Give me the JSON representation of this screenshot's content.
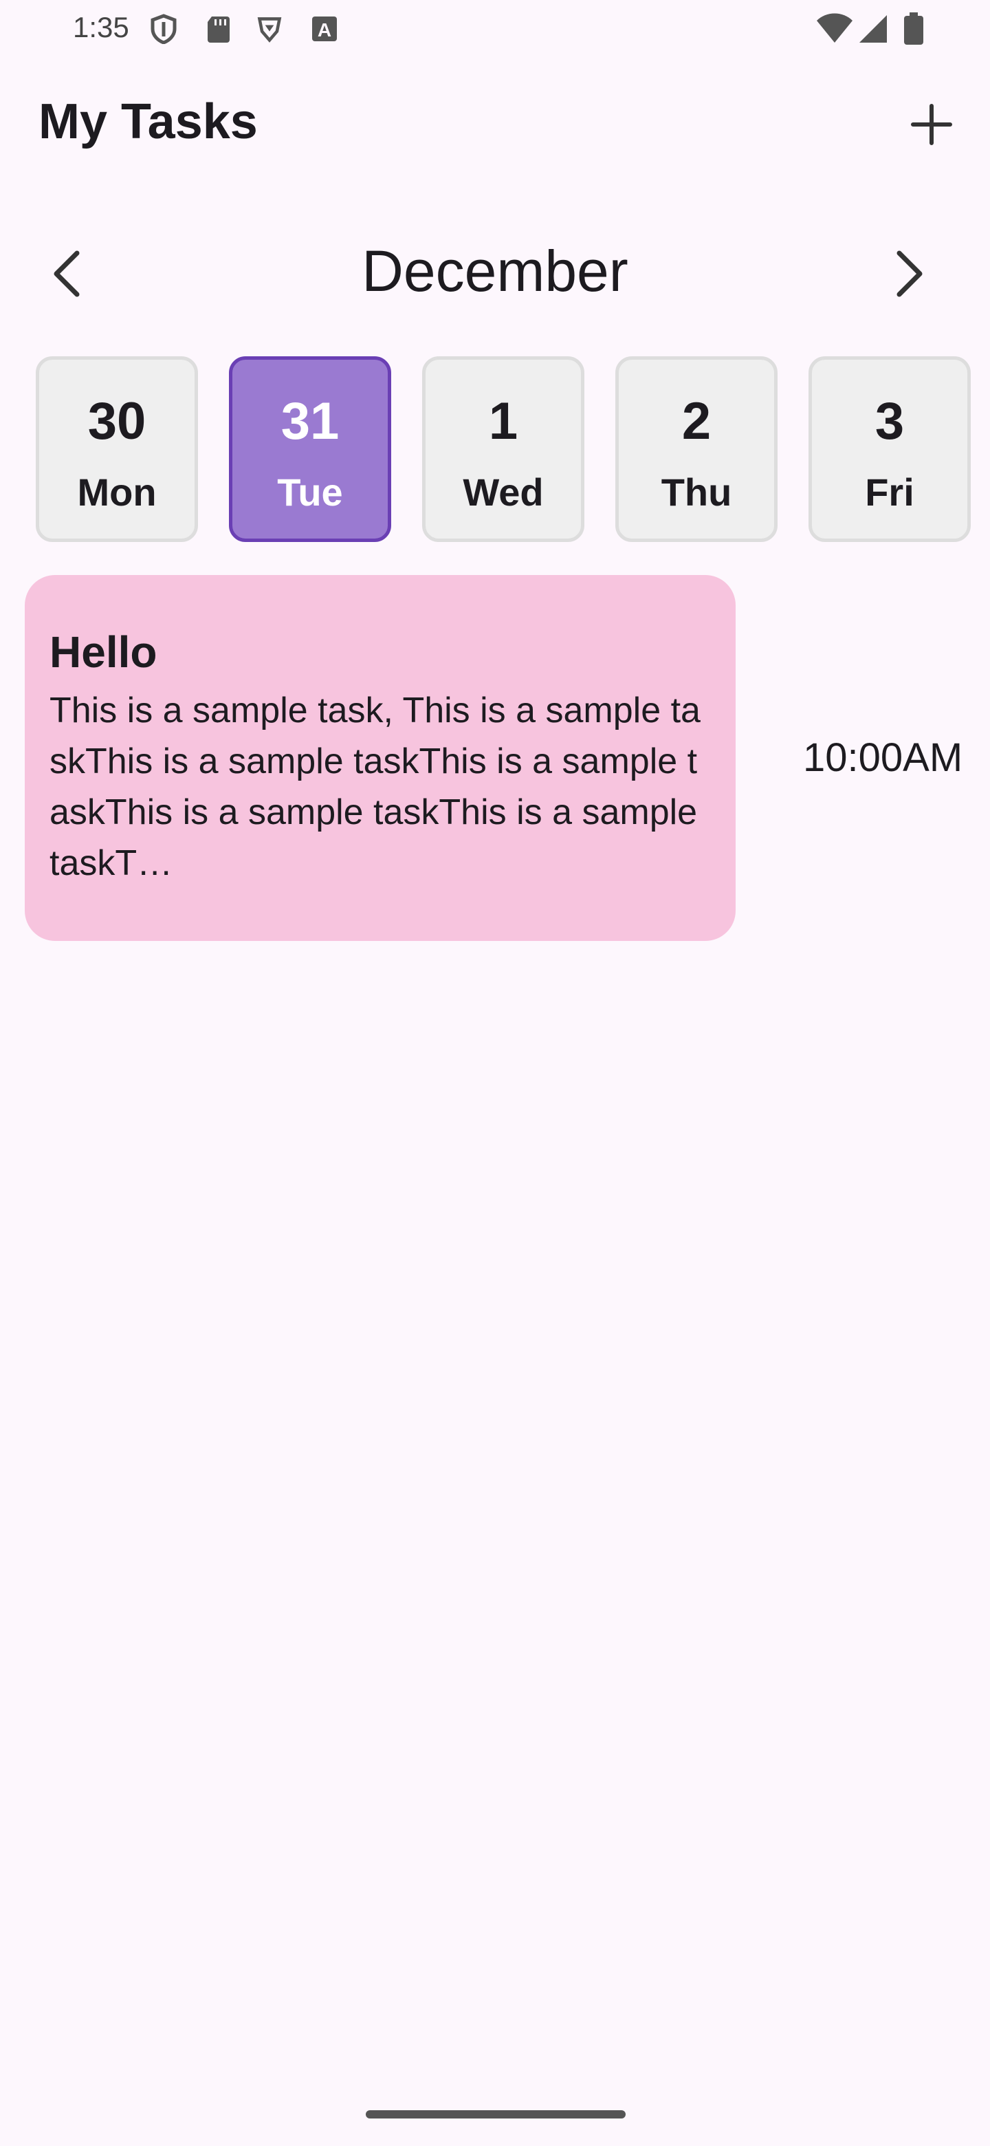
{
  "status_bar": {
    "time": "1:35",
    "icons_left": [
      "vpn-shield-icon",
      "sd-card-icon",
      "brave-icon",
      "font-a-icon"
    ],
    "icons_right": [
      "wifi-icon",
      "signal-icon",
      "battery-icon"
    ]
  },
  "app_bar": {
    "title": "My Tasks",
    "add_icon": "plus-icon"
  },
  "calendar": {
    "month": "December",
    "prev_icon": "chevron-left-icon",
    "next_icon": "chevron-right-icon",
    "days": [
      {
        "num": "30",
        "name": "Mon",
        "selected": false
      },
      {
        "num": "31",
        "name": "Tue",
        "selected": true
      },
      {
        "num": "1",
        "name": "Wed",
        "selected": false
      },
      {
        "num": "2",
        "name": "Thu",
        "selected": false
      },
      {
        "num": "3",
        "name": "Fri",
        "selected": false
      }
    ]
  },
  "tasks": [
    {
      "title": "Hello",
      "description": "This is a sample task, This is a sample taskThis is a sample taskThis is a sample taskThis is a sample taskThis is a sample taskT…",
      "time": "10:00AM",
      "color": "#f7c4de"
    }
  ],
  "colors": {
    "background": "#fdf7fd",
    "selected_day": "#9a7ad1",
    "selected_day_border": "#6a3fb4",
    "day_card": "#efefef",
    "task_card": "#f7c4de"
  }
}
